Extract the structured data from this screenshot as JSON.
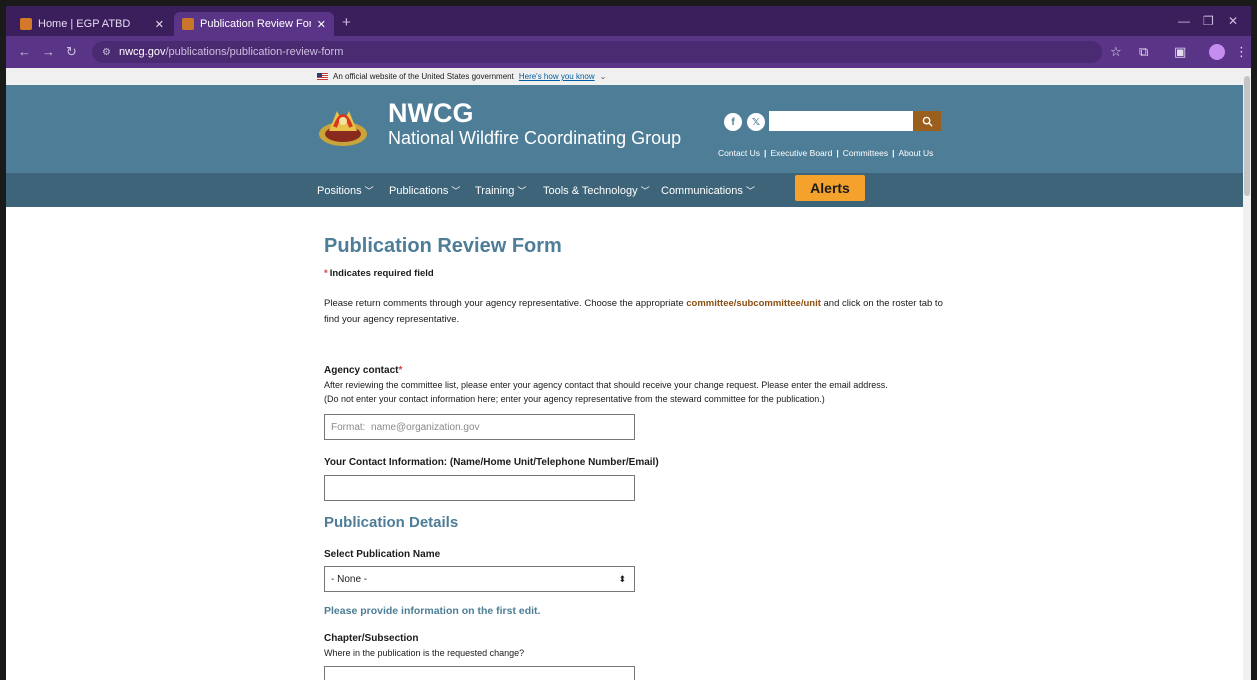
{
  "browser": {
    "tabs": [
      {
        "label": "Home | EGP ATBD",
        "active": false
      },
      {
        "label": "Publication Review Form | NWC",
        "active": true
      }
    ],
    "url_domain": "nwcg.gov",
    "url_path": "/publications/publication-review-form"
  },
  "gov_banner": {
    "text": "An official website of the United States government",
    "link": "Here's how you know"
  },
  "header": {
    "brand_title": "NWCG",
    "brand_subtitle": "National Wildfire Coordinating Group",
    "social": {
      "facebook": "f",
      "x": "𝕏"
    },
    "search_placeholder": "",
    "top_links": [
      "Contact Us",
      "Executive Board",
      "Committees",
      "About Us"
    ]
  },
  "nav": {
    "items": [
      "Positions",
      "Publications",
      "Training",
      "Tools & Technology",
      "Communications"
    ],
    "alerts": "Alerts"
  },
  "form": {
    "title": "Publication Review Form",
    "required_note": "Indicates required field",
    "intro_before": "Please return comments through your agency representative. Choose the appropriate ",
    "intro_link": "committee/subcommittee/unit",
    "intro_after": " and click on the roster tab to find your agency representative.",
    "agency_contact_label": "Agency contact",
    "agency_contact_desc1": "After reviewing the committee list, please enter your agency contact that should receive your change request.  Please enter the email address.",
    "agency_contact_desc2": " (Do not enter your contact information here; enter your agency representative from the steward committee for the publication.)",
    "agency_contact_placeholder": "Format:  name@organization.gov",
    "your_contact_label": "Your Contact Information: (Name/Home Unit/Telephone Number/Email)",
    "your_contact_value": "",
    "details_title": "Publication Details",
    "select_pub_label": "Select Publication Name",
    "select_pub_value": "- None -",
    "first_edit_note": "Please provide information on the first edit.",
    "chapter_label": "Chapter/Subsection",
    "chapter_desc": "Where in the publication is the requested change?"
  }
}
